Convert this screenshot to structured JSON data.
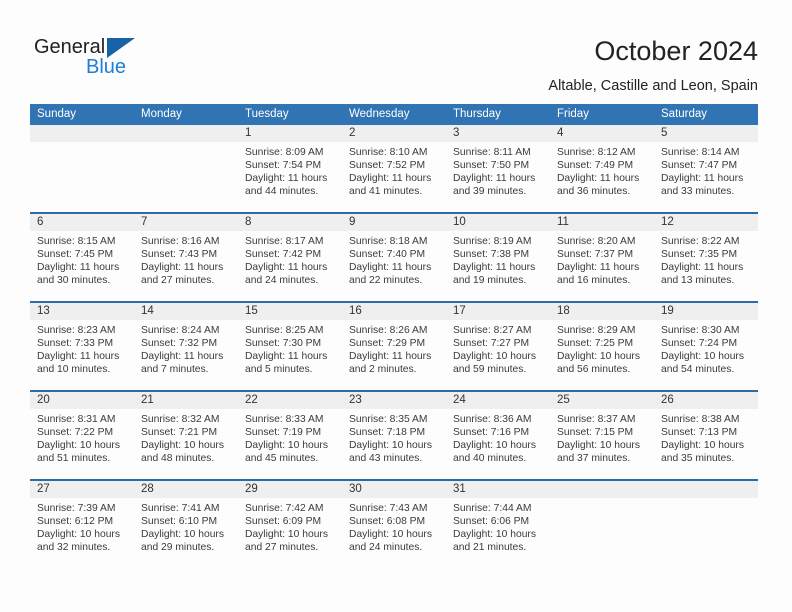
{
  "brand": {
    "line1": "General",
    "line2": "Blue",
    "triangle_icon": "triangle-icon",
    "accent_dark": "#1763a6",
    "accent_blue": "#1b7fd4"
  },
  "header": {
    "title": "October 2024",
    "subtitle": "Altable, Castille and Leon, Spain"
  },
  "theme": {
    "header_blue": "#3174b4",
    "row_divider_blue": "#2a6ca8",
    "date_strip_gray": "#efefef",
    "text_color": "#3b3b3b"
  },
  "calendar": {
    "day_names": [
      "Sunday",
      "Monday",
      "Tuesday",
      "Wednesday",
      "Thursday",
      "Friday",
      "Saturday"
    ],
    "weeks": [
      [
        {
          "date": "",
          "empty": true
        },
        {
          "date": "",
          "empty": true
        },
        {
          "date": "1",
          "sunrise": "Sunrise: 8:09 AM",
          "sunset": "Sunset: 7:54 PM",
          "daylight_l1": "Daylight: 11 hours",
          "daylight_l2": "and 44 minutes."
        },
        {
          "date": "2",
          "sunrise": "Sunrise: 8:10 AM",
          "sunset": "Sunset: 7:52 PM",
          "daylight_l1": "Daylight: 11 hours",
          "daylight_l2": "and 41 minutes."
        },
        {
          "date": "3",
          "sunrise": "Sunrise: 8:11 AM",
          "sunset": "Sunset: 7:50 PM",
          "daylight_l1": "Daylight: 11 hours",
          "daylight_l2": "and 39 minutes."
        },
        {
          "date": "4",
          "sunrise": "Sunrise: 8:12 AM",
          "sunset": "Sunset: 7:49 PM",
          "daylight_l1": "Daylight: 11 hours",
          "daylight_l2": "and 36 minutes."
        },
        {
          "date": "5",
          "sunrise": "Sunrise: 8:14 AM",
          "sunset": "Sunset: 7:47 PM",
          "daylight_l1": "Daylight: 11 hours",
          "daylight_l2": "and 33 minutes."
        }
      ],
      [
        {
          "date": "6",
          "sunrise": "Sunrise: 8:15 AM",
          "sunset": "Sunset: 7:45 PM",
          "daylight_l1": "Daylight: 11 hours",
          "daylight_l2": "and 30 minutes."
        },
        {
          "date": "7",
          "sunrise": "Sunrise: 8:16 AM",
          "sunset": "Sunset: 7:43 PM",
          "daylight_l1": "Daylight: 11 hours",
          "daylight_l2": "and 27 minutes."
        },
        {
          "date": "8",
          "sunrise": "Sunrise: 8:17 AM",
          "sunset": "Sunset: 7:42 PM",
          "daylight_l1": "Daylight: 11 hours",
          "daylight_l2": "and 24 minutes."
        },
        {
          "date": "9",
          "sunrise": "Sunrise: 8:18 AM",
          "sunset": "Sunset: 7:40 PM",
          "daylight_l1": "Daylight: 11 hours",
          "daylight_l2": "and 22 minutes."
        },
        {
          "date": "10",
          "sunrise": "Sunrise: 8:19 AM",
          "sunset": "Sunset: 7:38 PM",
          "daylight_l1": "Daylight: 11 hours",
          "daylight_l2": "and 19 minutes."
        },
        {
          "date": "11",
          "sunrise": "Sunrise: 8:20 AM",
          "sunset": "Sunset: 7:37 PM",
          "daylight_l1": "Daylight: 11 hours",
          "daylight_l2": "and 16 minutes."
        },
        {
          "date": "12",
          "sunrise": "Sunrise: 8:22 AM",
          "sunset": "Sunset: 7:35 PM",
          "daylight_l1": "Daylight: 11 hours",
          "daylight_l2": "and 13 minutes."
        }
      ],
      [
        {
          "date": "13",
          "sunrise": "Sunrise: 8:23 AM",
          "sunset": "Sunset: 7:33 PM",
          "daylight_l1": "Daylight: 11 hours",
          "daylight_l2": "and 10 minutes."
        },
        {
          "date": "14",
          "sunrise": "Sunrise: 8:24 AM",
          "sunset": "Sunset: 7:32 PM",
          "daylight_l1": "Daylight: 11 hours",
          "daylight_l2": "and 7 minutes."
        },
        {
          "date": "15",
          "sunrise": "Sunrise: 8:25 AM",
          "sunset": "Sunset: 7:30 PM",
          "daylight_l1": "Daylight: 11 hours",
          "daylight_l2": "and 5 minutes."
        },
        {
          "date": "16",
          "sunrise": "Sunrise: 8:26 AM",
          "sunset": "Sunset: 7:29 PM",
          "daylight_l1": "Daylight: 11 hours",
          "daylight_l2": "and 2 minutes."
        },
        {
          "date": "17",
          "sunrise": "Sunrise: 8:27 AM",
          "sunset": "Sunset: 7:27 PM",
          "daylight_l1": "Daylight: 10 hours",
          "daylight_l2": "and 59 minutes."
        },
        {
          "date": "18",
          "sunrise": "Sunrise: 8:29 AM",
          "sunset": "Sunset: 7:25 PM",
          "daylight_l1": "Daylight: 10 hours",
          "daylight_l2": "and 56 minutes."
        },
        {
          "date": "19",
          "sunrise": "Sunrise: 8:30 AM",
          "sunset": "Sunset: 7:24 PM",
          "daylight_l1": "Daylight: 10 hours",
          "daylight_l2": "and 54 minutes."
        }
      ],
      [
        {
          "date": "20",
          "sunrise": "Sunrise: 8:31 AM",
          "sunset": "Sunset: 7:22 PM",
          "daylight_l1": "Daylight: 10 hours",
          "daylight_l2": "and 51 minutes."
        },
        {
          "date": "21",
          "sunrise": "Sunrise: 8:32 AM",
          "sunset": "Sunset: 7:21 PM",
          "daylight_l1": "Daylight: 10 hours",
          "daylight_l2": "and 48 minutes."
        },
        {
          "date": "22",
          "sunrise": "Sunrise: 8:33 AM",
          "sunset": "Sunset: 7:19 PM",
          "daylight_l1": "Daylight: 10 hours",
          "daylight_l2": "and 45 minutes."
        },
        {
          "date": "23",
          "sunrise": "Sunrise: 8:35 AM",
          "sunset": "Sunset: 7:18 PM",
          "daylight_l1": "Daylight: 10 hours",
          "daylight_l2": "and 43 minutes."
        },
        {
          "date": "24",
          "sunrise": "Sunrise: 8:36 AM",
          "sunset": "Sunset: 7:16 PM",
          "daylight_l1": "Daylight: 10 hours",
          "daylight_l2": "and 40 minutes."
        },
        {
          "date": "25",
          "sunrise": "Sunrise: 8:37 AM",
          "sunset": "Sunset: 7:15 PM",
          "daylight_l1": "Daylight: 10 hours",
          "daylight_l2": "and 37 minutes."
        },
        {
          "date": "26",
          "sunrise": "Sunrise: 8:38 AM",
          "sunset": "Sunset: 7:13 PM",
          "daylight_l1": "Daylight: 10 hours",
          "daylight_l2": "and 35 minutes."
        }
      ],
      [
        {
          "date": "27",
          "sunrise": "Sunrise: 7:39 AM",
          "sunset": "Sunset: 6:12 PM",
          "daylight_l1": "Daylight: 10 hours",
          "daylight_l2": "and 32 minutes."
        },
        {
          "date": "28",
          "sunrise": "Sunrise: 7:41 AM",
          "sunset": "Sunset: 6:10 PM",
          "daylight_l1": "Daylight: 10 hours",
          "daylight_l2": "and 29 minutes."
        },
        {
          "date": "29",
          "sunrise": "Sunrise: 7:42 AM",
          "sunset": "Sunset: 6:09 PM",
          "daylight_l1": "Daylight: 10 hours",
          "daylight_l2": "and 27 minutes."
        },
        {
          "date": "30",
          "sunrise": "Sunrise: 7:43 AM",
          "sunset": "Sunset: 6:08 PM",
          "daylight_l1": "Daylight: 10 hours",
          "daylight_l2": "and 24 minutes."
        },
        {
          "date": "31",
          "sunrise": "Sunrise: 7:44 AM",
          "sunset": "Sunset: 6:06 PM",
          "daylight_l1": "Daylight: 10 hours",
          "daylight_l2": "and 21 minutes."
        },
        {
          "date": "",
          "empty": true
        },
        {
          "date": "",
          "empty": true
        }
      ]
    ]
  }
}
